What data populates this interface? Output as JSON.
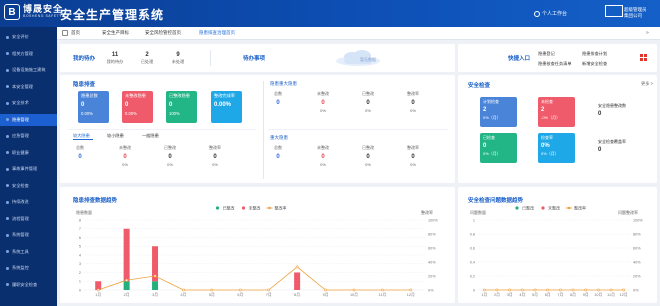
{
  "header": {
    "logo_mark": "B",
    "logo_name": "博晟安全",
    "logo_sub": "BOSHENG SAFETY",
    "title": "安全生产管理系统",
    "workbench": "个人工作台",
    "user_line1": "超级管理员",
    "user_line2": "集团公司"
  },
  "sidebar": {
    "items": [
      {
        "label": "安全评价",
        "active": false
      },
      {
        "label": "相关方管理",
        "active": false
      },
      {
        "label": "设备设施施工建筑",
        "active": false
      },
      {
        "label": "本安全管理",
        "active": false
      },
      {
        "label": "安全技术",
        "active": false
      },
      {
        "label": "隐患管理",
        "active": true
      },
      {
        "label": "应急管理",
        "active": false
      },
      {
        "label": "职业健康",
        "active": false
      },
      {
        "label": "事故事件管理",
        "active": false
      },
      {
        "label": "安全检查",
        "active": false
      },
      {
        "label": "持续改进",
        "active": false
      },
      {
        "label": "流程管理",
        "active": false
      },
      {
        "label": "系统管理",
        "active": false
      },
      {
        "label": "系统工具",
        "active": false
      },
      {
        "label": "系统监控",
        "active": false
      },
      {
        "label": "履职安全检查",
        "active": false
      }
    ]
  },
  "tabs": {
    "items": [
      {
        "label": "首页",
        "active": false
      },
      {
        "label": "安全生产目标",
        "active": false
      },
      {
        "label": "安全风险管控首页",
        "active": false
      },
      {
        "label": "隐患排查治理首页",
        "active": true
      }
    ],
    "right_icon": "»"
  },
  "todo": {
    "title": "我的待办",
    "kpis": [
      {
        "label": "我的待办",
        "value": "11"
      },
      {
        "label": "已处理",
        "value": "2"
      },
      {
        "label": "未处理",
        "value": "9"
      }
    ],
    "pending_title": "待办事项",
    "empty_text": "暂无数据"
  },
  "quick": {
    "title": "快捷入口",
    "links": [
      "隐患登记",
      "隐患排查计划",
      "隐患核查任务清单",
      "新增安全检查"
    ]
  },
  "hidden": {
    "title": "隐患排查",
    "stat_boxes": [
      {
        "label": "隐患总数",
        "value": "0",
        "pct": "0.00%",
        "color": "#4a84d8"
      },
      {
        "label": "未整改隐患",
        "value": "0",
        "pct": "0.00%",
        "color": "#ef5b6a"
      },
      {
        "label": "已整改隐患",
        "value": "0",
        "pct": "100%",
        "color": "#22b585"
      },
      {
        "label": "整改完成率",
        "value": "0.00%",
        "pct": "",
        "color": "#1ea8e8"
      }
    ],
    "major": {
      "title": "隐患重大隐患",
      "cells": [
        {
          "label": "总数",
          "value": "0",
          "pct": "",
          "cls": "blue"
        },
        {
          "label": "未整改",
          "value": "0",
          "pct": "0%",
          "cls": "red"
        },
        {
          "label": "已整改",
          "value": "0",
          "pct": "0%",
          "cls": "dark"
        },
        {
          "label": "整改率",
          "value": "0",
          "pct": "0%",
          "cls": "dark"
        }
      ]
    },
    "levels": {
      "tabs": [
        "较大隐患",
        "较小隐患",
        "一般隐患"
      ],
      "cells": [
        {
          "label": "总数",
          "value": "0",
          "pct": "",
          "cls": "blue"
        },
        {
          "label": "未整改",
          "value": "0",
          "pct": "0%",
          "cls": "red"
        },
        {
          "label": "已整改",
          "value": "0",
          "pct": "0%",
          "cls": "dark"
        },
        {
          "label": "整改率",
          "value": "0",
          "pct": "0%",
          "cls": "dark"
        }
      ]
    },
    "important": {
      "title": "重大隐患",
      "cells": [
        {
          "label": "总数",
          "value": "0",
          "pct": "",
          "cls": "blue"
        },
        {
          "label": "未整改",
          "value": "0",
          "pct": "0%",
          "cls": "red"
        },
        {
          "label": "已整改",
          "value": "0",
          "pct": "0%",
          "cls": "dark"
        },
        {
          "label": "整改率",
          "value": "0",
          "pct": "0%",
          "cls": "dark"
        }
      ]
    }
  },
  "safety": {
    "title": "安全检查",
    "more": "更多 >",
    "boxes": [
      {
        "label": "计划检查",
        "value": "2",
        "pct": "0%（月）",
        "color": "#4a84d8"
      },
      {
        "label": "未检查",
        "value": "2",
        "pct": "-0%（月）",
        "color": "#ef5b6a"
      },
      {
        "label": "已检查",
        "value": "0",
        "pct": "0%（月）",
        "color": "#22b585"
      },
      {
        "label": "检查率",
        "value": "0%",
        "pct": "0%（月）",
        "color": "#1ea8e8"
      }
    ],
    "side_stats": [
      {
        "label": "安全隐患整改数",
        "value": "0"
      },
      {
        "label": "安全检查覆盖率",
        "value": "0"
      }
    ]
  },
  "trend": {
    "title": "隐患排查数据趋势"
  },
  "safe_trend": {
    "title": "安全检查问题数据趋势"
  },
  "chart_data": [
    {
      "type": "bar",
      "title": "隐患排查数据趋势",
      "ylabel": "隐患数量",
      "y2label": "整改率",
      "categories": [
        "1月",
        "2月",
        "3月",
        "4月",
        "5月",
        "6月",
        "7月",
        "8月",
        "9月",
        "10月",
        "11月",
        "12月"
      ],
      "ylim": [
        0,
        8
      ],
      "y2lim": [
        0,
        100
      ],
      "yticks": [
        0,
        1,
        2,
        3,
        4,
        5,
        6,
        7,
        8
      ],
      "y2ticks": [
        "0%",
        "20%",
        "40%",
        "60%",
        "80%",
        "100%"
      ],
      "stacked": true,
      "series": [
        {
          "name": "已整改",
          "type": "bar",
          "color": "#23b07d",
          "values": [
            0,
            1,
            1,
            0,
            0,
            0,
            0,
            0,
            0,
            0,
            0,
            0
          ]
        },
        {
          "name": "未整改",
          "type": "bar",
          "color": "#ef5b6a",
          "values": [
            1,
            6,
            4,
            0,
            0,
            0,
            0,
            2,
            0,
            0,
            0,
            0
          ]
        },
        {
          "name": "整改率",
          "type": "line",
          "color": "#f0a03a",
          "values": [
            0,
            14,
            20,
            0,
            0,
            0,
            0,
            33,
            0,
            0,
            0,
            0
          ]
        }
      ],
      "legend": "top-center",
      "grid": true
    },
    {
      "type": "bar",
      "title": "安全检查问题数据趋势",
      "ylabel": "问题数量",
      "y2label": "问题整改率",
      "categories": [
        "1月",
        "2月",
        "3月",
        "4月",
        "5月",
        "6月",
        "7月",
        "8月",
        "9月",
        "10月",
        "11月",
        "12月"
      ],
      "ylim": [
        0,
        1
      ],
      "y2lim": [
        0,
        100
      ],
      "yticks": [
        0,
        0.2,
        0.4,
        0.6,
        0.8,
        1
      ],
      "y2ticks": [
        "0%",
        "20%",
        "40%",
        "60%",
        "80%",
        "100%"
      ],
      "stacked": true,
      "series": [
        {
          "name": "已整改",
          "type": "bar",
          "color": "#23b07d",
          "values": [
            0,
            0,
            0,
            0,
            0,
            0,
            0,
            0,
            0,
            0,
            0,
            0
          ]
        },
        {
          "name": "未整改",
          "type": "bar",
          "color": "#ef5b6a",
          "values": [
            0,
            0,
            0,
            0,
            0,
            0,
            0,
            0,
            0,
            0,
            0,
            0
          ]
        },
        {
          "name": "整改率",
          "type": "line",
          "color": "#f0a03a",
          "values": [
            0,
            0,
            0,
            0,
            0,
            0,
            0,
            0,
            0,
            0,
            0,
            0
          ]
        }
      ],
      "legend": "top-center",
      "grid": true
    }
  ]
}
